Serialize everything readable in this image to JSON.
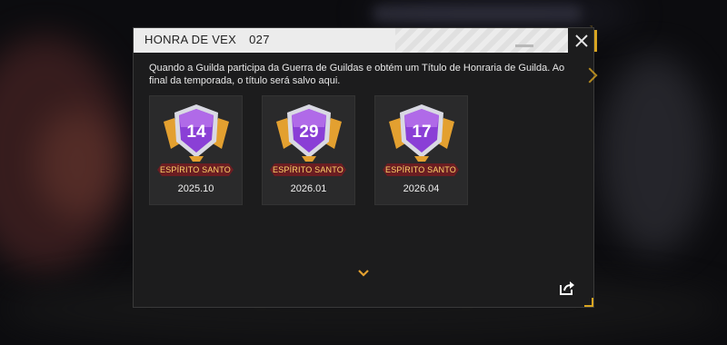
{
  "dialog": {
    "title": "HONRA DE VEX",
    "code": "027",
    "close_icon": "close-icon",
    "description": "Quando a Guilda participa da Guerra de Guildas e obtém um Título de Honraria de Guilda. Ao final da temporada, o título será salvo aqui."
  },
  "badges": [
    {
      "rank": "14",
      "title": "ESPÍRITO SANTO",
      "date": "2025.10"
    },
    {
      "rank": "29",
      "title": "ESPÍRITO SANTO",
      "date": "2026.01"
    },
    {
      "rank": "17",
      "title": "ESPÍRITO SANTO",
      "date": "2026.04"
    }
  ],
  "icons": {
    "more": "chevron-down-icon",
    "share": "share-icon"
  },
  "colors": {
    "accent": "#d9a521",
    "header_bg": "#ececec",
    "panel_bg": "#1c1c1d",
    "ribbon": "#6b1d22",
    "badge_purple": "#8a3fd6"
  }
}
